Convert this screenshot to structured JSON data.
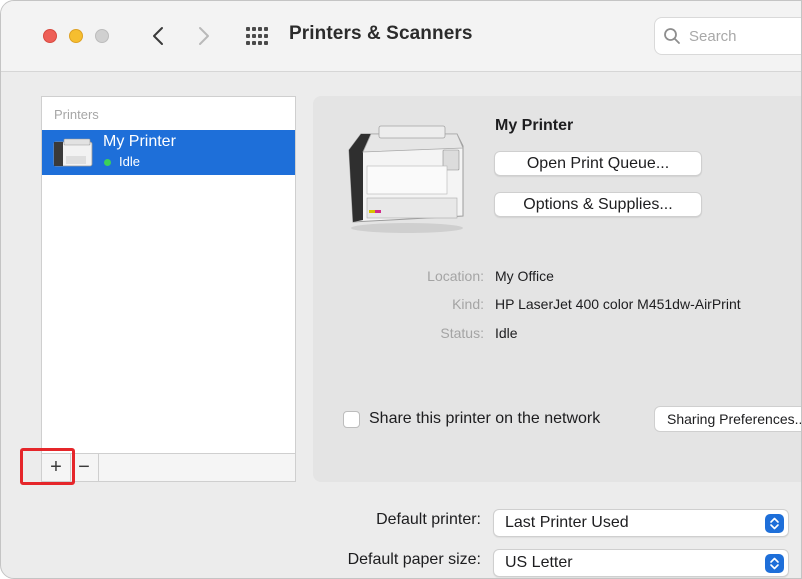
{
  "window": {
    "title": "Printers & Scanners"
  },
  "toolbar": {
    "back_icon": "chevron-left-icon",
    "forward_icon": "chevron-right-icon",
    "grid_icon": "grid-icon"
  },
  "search": {
    "placeholder": "Search",
    "icon": "search-icon"
  },
  "sidebar": {
    "header": "Printers",
    "items": [
      {
        "name": "My Printer",
        "status": "Idle",
        "status_color": "#3bd15a",
        "selected": true
      }
    ],
    "add_label": "+",
    "remove_label": "−"
  },
  "detail": {
    "printer_name": "My Printer",
    "open_queue_label": "Open Print Queue...",
    "options_label": "Options & Supplies...",
    "info": {
      "location_label": "Location:",
      "location_value": "My Office",
      "kind_label": "Kind:",
      "kind_value": "HP LaserJet 400 color M451dw-AirPrint",
      "status_label": "Status:",
      "status_value": "Idle"
    },
    "share_label": "Share this printer on the network",
    "share_checked": false,
    "sharing_prefs_label": "Sharing Preferences..."
  },
  "preferences": {
    "default_printer_label": "Default printer:",
    "default_printer_value": "Last Printer Used",
    "paper_size_label": "Default paper size:",
    "paper_size_value": "US Letter"
  },
  "colors": {
    "selection": "#1e6fd9",
    "highlight_box": "#e5262a",
    "close": "#ee5f57",
    "minimize": "#f6be2f",
    "zoom_inactive": "#d0d0d0"
  }
}
